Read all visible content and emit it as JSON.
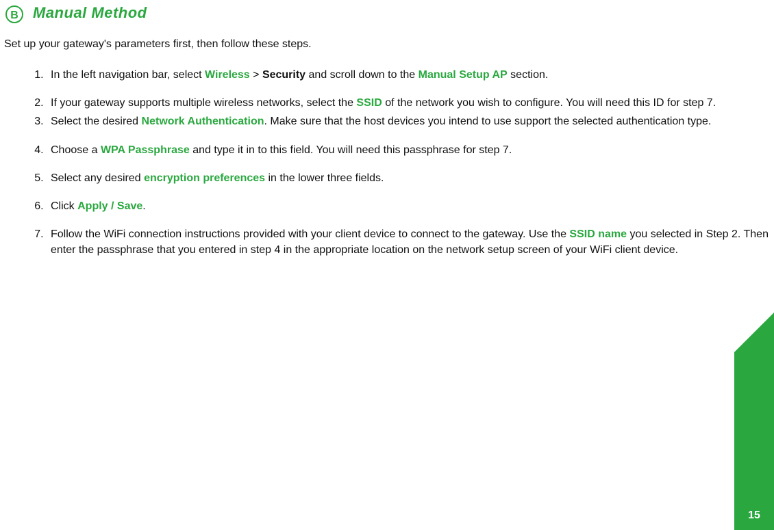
{
  "badge": "B",
  "title": "Manual Method",
  "intro": "Set up your gateway's parameters first, then follow these steps.",
  "pageNumber": "15",
  "steps": {
    "s1": {
      "t1": "In the left navigation bar, select ",
      "wireless": "Wireless",
      "gt": " > ",
      "security": "Security",
      "t2": " and scroll down to the ",
      "manual": "Manual Setup AP",
      "t3": " section."
    },
    "s2": {
      "t1": "If your gateway supports multiple wireless networks, select the ",
      "ssid": "SSID",
      "t2": " of the network you wish to configure. You will need this ID for step 7."
    },
    "s3": {
      "t1": "Select the desired ",
      "na": "Network Authentication",
      "t2": ". Make sure that the host devices you intend to use support the selected authentication type."
    },
    "s4": {
      "t1": "Choose a ",
      "wpa": "WPA Passphrase",
      "t2": " and type it in to this field. You will need this passphrase for step 7."
    },
    "s5": {
      "t1": "Select any desired ",
      "enc": "encryption preferences",
      "t2": " in the lower three fields."
    },
    "s6": {
      "t1": "Click ",
      "apply": "Apply / Save",
      "t2": "."
    },
    "s7": {
      "t1": "Follow the WiFi connection instructions provided with your client device to connect to the gateway. Use the ",
      "ssidname": "SSID name",
      "t2": " you selected in Step 2. Then enter the passphrase that you entered in step 4 in the appropriate location on the network setup screen of your WiFi client device."
    }
  }
}
